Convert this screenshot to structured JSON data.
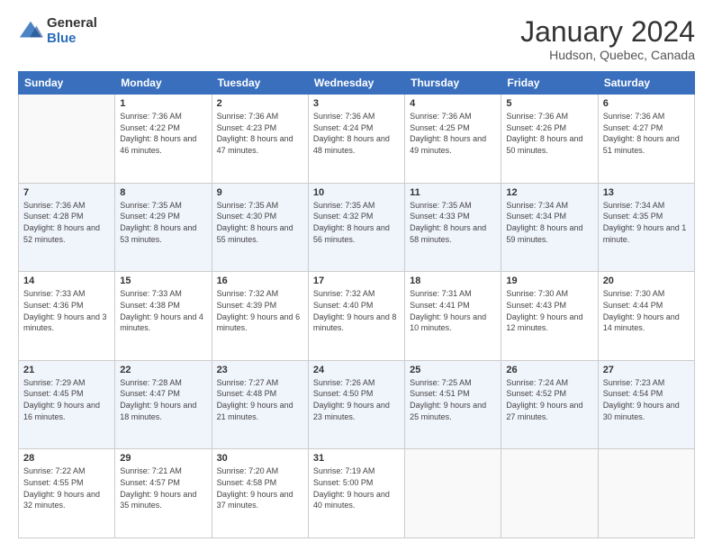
{
  "header": {
    "logo": {
      "general": "General",
      "blue": "Blue"
    },
    "title": "January 2024",
    "subtitle": "Hudson, Quebec, Canada"
  },
  "calendar": {
    "weekdays": [
      "Sunday",
      "Monday",
      "Tuesday",
      "Wednesday",
      "Thursday",
      "Friday",
      "Saturday"
    ],
    "weeks": [
      [
        {
          "day": "",
          "sunrise": "",
          "sunset": "",
          "daylight": ""
        },
        {
          "day": "1",
          "sunrise": "Sunrise: 7:36 AM",
          "sunset": "Sunset: 4:22 PM",
          "daylight": "Daylight: 8 hours and 46 minutes."
        },
        {
          "day": "2",
          "sunrise": "Sunrise: 7:36 AM",
          "sunset": "Sunset: 4:23 PM",
          "daylight": "Daylight: 8 hours and 47 minutes."
        },
        {
          "day": "3",
          "sunrise": "Sunrise: 7:36 AM",
          "sunset": "Sunset: 4:24 PM",
          "daylight": "Daylight: 8 hours and 48 minutes."
        },
        {
          "day": "4",
          "sunrise": "Sunrise: 7:36 AM",
          "sunset": "Sunset: 4:25 PM",
          "daylight": "Daylight: 8 hours and 49 minutes."
        },
        {
          "day": "5",
          "sunrise": "Sunrise: 7:36 AM",
          "sunset": "Sunset: 4:26 PM",
          "daylight": "Daylight: 8 hours and 50 minutes."
        },
        {
          "day": "6",
          "sunrise": "Sunrise: 7:36 AM",
          "sunset": "Sunset: 4:27 PM",
          "daylight": "Daylight: 8 hours and 51 minutes."
        }
      ],
      [
        {
          "day": "7",
          "sunrise": "Sunrise: 7:36 AM",
          "sunset": "Sunset: 4:28 PM",
          "daylight": "Daylight: 8 hours and 52 minutes."
        },
        {
          "day": "8",
          "sunrise": "Sunrise: 7:35 AM",
          "sunset": "Sunset: 4:29 PM",
          "daylight": "Daylight: 8 hours and 53 minutes."
        },
        {
          "day": "9",
          "sunrise": "Sunrise: 7:35 AM",
          "sunset": "Sunset: 4:30 PM",
          "daylight": "Daylight: 8 hours and 55 minutes."
        },
        {
          "day": "10",
          "sunrise": "Sunrise: 7:35 AM",
          "sunset": "Sunset: 4:32 PM",
          "daylight": "Daylight: 8 hours and 56 minutes."
        },
        {
          "day": "11",
          "sunrise": "Sunrise: 7:35 AM",
          "sunset": "Sunset: 4:33 PM",
          "daylight": "Daylight: 8 hours and 58 minutes."
        },
        {
          "day": "12",
          "sunrise": "Sunrise: 7:34 AM",
          "sunset": "Sunset: 4:34 PM",
          "daylight": "Daylight: 8 hours and 59 minutes."
        },
        {
          "day": "13",
          "sunrise": "Sunrise: 7:34 AM",
          "sunset": "Sunset: 4:35 PM",
          "daylight": "Daylight: 9 hours and 1 minute."
        }
      ],
      [
        {
          "day": "14",
          "sunrise": "Sunrise: 7:33 AM",
          "sunset": "Sunset: 4:36 PM",
          "daylight": "Daylight: 9 hours and 3 minutes."
        },
        {
          "day": "15",
          "sunrise": "Sunrise: 7:33 AM",
          "sunset": "Sunset: 4:38 PM",
          "daylight": "Daylight: 9 hours and 4 minutes."
        },
        {
          "day": "16",
          "sunrise": "Sunrise: 7:32 AM",
          "sunset": "Sunset: 4:39 PM",
          "daylight": "Daylight: 9 hours and 6 minutes."
        },
        {
          "day": "17",
          "sunrise": "Sunrise: 7:32 AM",
          "sunset": "Sunset: 4:40 PM",
          "daylight": "Daylight: 9 hours and 8 minutes."
        },
        {
          "day": "18",
          "sunrise": "Sunrise: 7:31 AM",
          "sunset": "Sunset: 4:41 PM",
          "daylight": "Daylight: 9 hours and 10 minutes."
        },
        {
          "day": "19",
          "sunrise": "Sunrise: 7:30 AM",
          "sunset": "Sunset: 4:43 PM",
          "daylight": "Daylight: 9 hours and 12 minutes."
        },
        {
          "day": "20",
          "sunrise": "Sunrise: 7:30 AM",
          "sunset": "Sunset: 4:44 PM",
          "daylight": "Daylight: 9 hours and 14 minutes."
        }
      ],
      [
        {
          "day": "21",
          "sunrise": "Sunrise: 7:29 AM",
          "sunset": "Sunset: 4:45 PM",
          "daylight": "Daylight: 9 hours and 16 minutes."
        },
        {
          "day": "22",
          "sunrise": "Sunrise: 7:28 AM",
          "sunset": "Sunset: 4:47 PM",
          "daylight": "Daylight: 9 hours and 18 minutes."
        },
        {
          "day": "23",
          "sunrise": "Sunrise: 7:27 AM",
          "sunset": "Sunset: 4:48 PM",
          "daylight": "Daylight: 9 hours and 21 minutes."
        },
        {
          "day": "24",
          "sunrise": "Sunrise: 7:26 AM",
          "sunset": "Sunset: 4:50 PM",
          "daylight": "Daylight: 9 hours and 23 minutes."
        },
        {
          "day": "25",
          "sunrise": "Sunrise: 7:25 AM",
          "sunset": "Sunset: 4:51 PM",
          "daylight": "Daylight: 9 hours and 25 minutes."
        },
        {
          "day": "26",
          "sunrise": "Sunrise: 7:24 AM",
          "sunset": "Sunset: 4:52 PM",
          "daylight": "Daylight: 9 hours and 27 minutes."
        },
        {
          "day": "27",
          "sunrise": "Sunrise: 7:23 AM",
          "sunset": "Sunset: 4:54 PM",
          "daylight": "Daylight: 9 hours and 30 minutes."
        }
      ],
      [
        {
          "day": "28",
          "sunrise": "Sunrise: 7:22 AM",
          "sunset": "Sunset: 4:55 PM",
          "daylight": "Daylight: 9 hours and 32 minutes."
        },
        {
          "day": "29",
          "sunrise": "Sunrise: 7:21 AM",
          "sunset": "Sunset: 4:57 PM",
          "daylight": "Daylight: 9 hours and 35 minutes."
        },
        {
          "day": "30",
          "sunrise": "Sunrise: 7:20 AM",
          "sunset": "Sunset: 4:58 PM",
          "daylight": "Daylight: 9 hours and 37 minutes."
        },
        {
          "day": "31",
          "sunrise": "Sunrise: 7:19 AM",
          "sunset": "Sunset: 5:00 PM",
          "daylight": "Daylight: 9 hours and 40 minutes."
        },
        {
          "day": "",
          "sunrise": "",
          "sunset": "",
          "daylight": ""
        },
        {
          "day": "",
          "sunrise": "",
          "sunset": "",
          "daylight": ""
        },
        {
          "day": "",
          "sunrise": "",
          "sunset": "",
          "daylight": ""
        }
      ]
    ]
  }
}
